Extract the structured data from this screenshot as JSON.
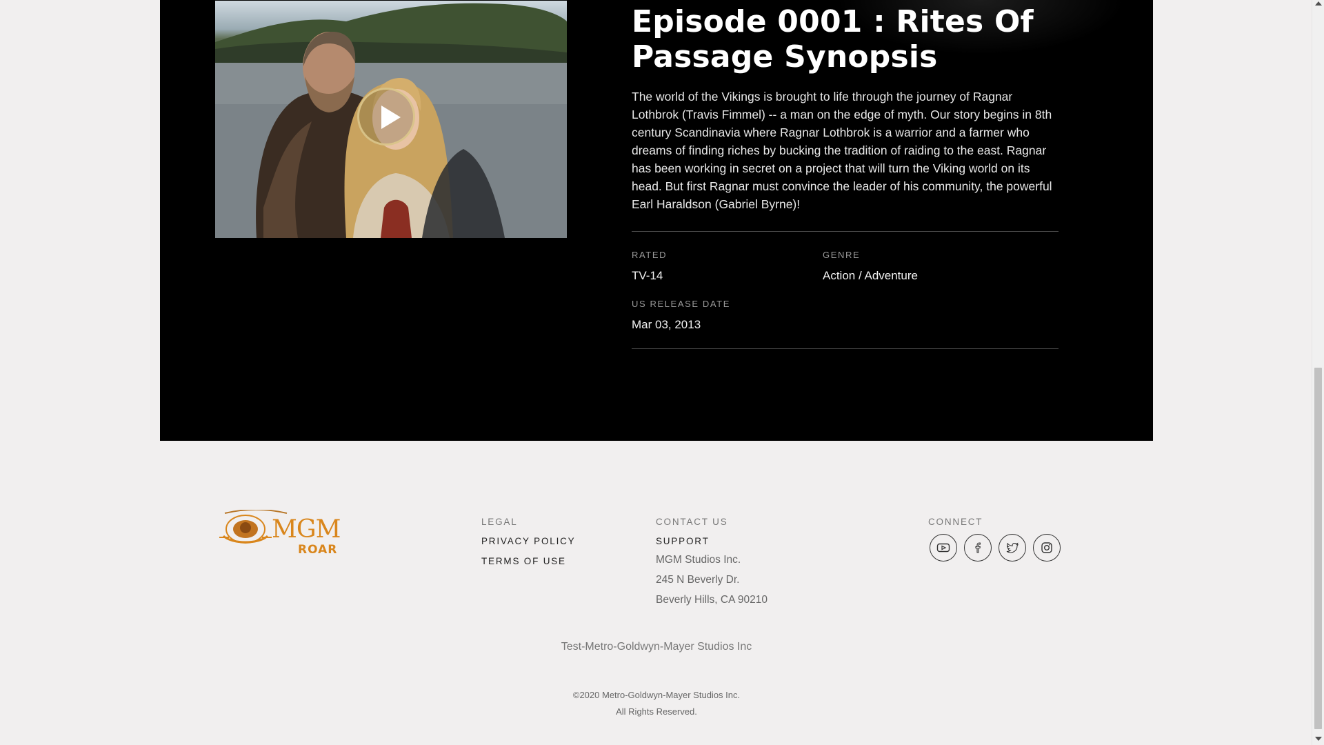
{
  "episode": {
    "title": "Episode 0001 : Rites Of Passage Synopsis",
    "synopsis": "The world of the Vikings is brought to life through the journey of Ragnar Lothbrok (Travis Fimmel) -- a man on the edge of myth. Our story begins in 8th century Scandinavia where Ragnar Lothbrok is a warrior and a farmer who dreams of finding riches by bucking the tradition of raiding to the east. Ragnar has been working in secret on a project that will turn the Viking world on its head. But first Ragnar must convince the leader of his community, the powerful Earl Haraldson (Gabriel Byrne)!",
    "meta": {
      "rated_label": "RATED",
      "rated_value": "TV-14",
      "genre_label": "GENRE",
      "genre_value": "Action / Adventure",
      "release_label": "US RELEASE DATE",
      "release_value": "Mar 03, 2013"
    },
    "video": {
      "play_icon": "play-icon"
    }
  },
  "footer": {
    "logo": {
      "text": "MGM",
      "subtext": "ROAR",
      "color": "#d9861c"
    },
    "legal": {
      "heading": "LEGAL",
      "links": [
        "PRIVACY POLICY",
        "TERMS OF USE"
      ]
    },
    "contact": {
      "heading": "CONTACT US",
      "support": "SUPPORT",
      "address": [
        "MGM Studios Inc.",
        "245 N Beverly Dr.",
        "Beverly Hills, CA 90210"
      ]
    },
    "connect": {
      "heading": "CONNECT",
      "icons": [
        "youtube-icon",
        "facebook-icon",
        "twitter-icon",
        "instagram-icon"
      ]
    },
    "company_line": "Test-Metro-Goldwyn-Mayer Studios Inc",
    "copyright_line1": "©2020 Metro-Goldwyn-Mayer Studios Inc.",
    "copyright_line2": "All Rights Reserved."
  },
  "colors": {
    "hero_background": "#000000",
    "footer_background": "#f1efef",
    "logo_gold": "#d9861c"
  }
}
